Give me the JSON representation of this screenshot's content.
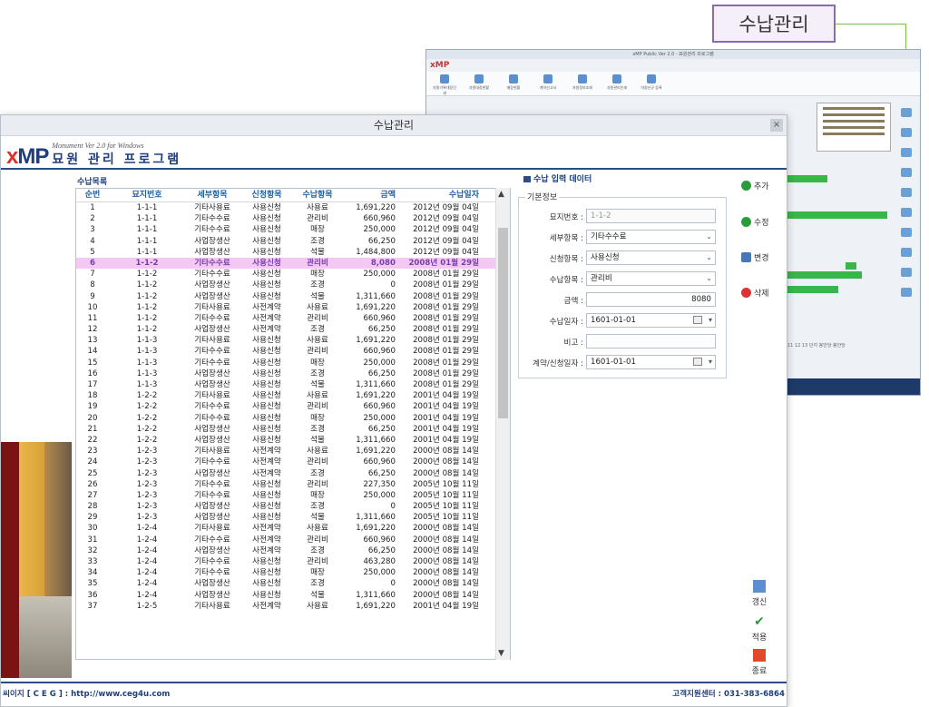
{
  "callout": {
    "label": "수납관리"
  },
  "background_window": {
    "title": "xMP Public Ver 2.0 - 묘원관리 프로그램",
    "logo": "xMP",
    "toolbar": [
      "자원기록대장인쇄",
      "자원대장현황",
      "매장현황",
      "계약신고서",
      "자원정보조회",
      "자원관리인쇄",
      "자원신규 등록"
    ],
    "pager": "11  12  13  단지  봉안당  봉안당"
  },
  "window": {
    "title": "수납관리",
    "close_icon": "close-icon"
  },
  "brand": {
    "xmp_x": "x",
    "xmp_mp": "MP",
    "subtitle": "Monument Ver 2.0 for Windows",
    "title": "묘원 관리 프로그램"
  },
  "list": {
    "title": "수납목록",
    "headers": [
      "순번",
      "묘지번호",
      "세부항목",
      "신청항목",
      "수납항목",
      "금액",
      "수납일자"
    ],
    "selected_index": 5,
    "rows": [
      [
        "1",
        "1-1-1",
        "기타사용료",
        "사용신청",
        "사용료",
        "1,691,220",
        "2012년 09월 04일"
      ],
      [
        "2",
        "1-1-1",
        "기타수수료",
        "사용신청",
        "관리비",
        "660,960",
        "2012년 09월 04일"
      ],
      [
        "3",
        "1-1-1",
        "기타수수료",
        "사용신청",
        "매장",
        "250,000",
        "2012년 09월 04일"
      ],
      [
        "4",
        "1-1-1",
        "사업장생산",
        "사용신청",
        "조경",
        "66,250",
        "2012년 09월 04일"
      ],
      [
        "5",
        "1-1-1",
        "사업장생산",
        "사용신청",
        "석물",
        "1,484,800",
        "2012년 09월 04일"
      ],
      [
        "6",
        "1-1-2",
        "기타수수료",
        "사용신청",
        "관리비",
        "8,080",
        "2008년 01월 29일"
      ],
      [
        "7",
        "1-1-2",
        "기타수수료",
        "사용신청",
        "매장",
        "250,000",
        "2008년 01월 29일"
      ],
      [
        "8",
        "1-1-2",
        "사업장생산",
        "사용신청",
        "조경",
        "0",
        "2008년 01월 29일"
      ],
      [
        "9",
        "1-1-2",
        "사업장생산",
        "사용신청",
        "석물",
        "1,311,660",
        "2008년 01월 29일"
      ],
      [
        "10",
        "1-1-2",
        "기타사용료",
        "사전계약",
        "사용료",
        "1,691,220",
        "2008년 01월 29일"
      ],
      [
        "11",
        "1-1-2",
        "기타수수료",
        "사전계약",
        "관리비",
        "660,960",
        "2008년 01월 29일"
      ],
      [
        "12",
        "1-1-2",
        "사업장생산",
        "사전계약",
        "조경",
        "66,250",
        "2008년 01월 29일"
      ],
      [
        "13",
        "1-1-3",
        "기타사용료",
        "사용신청",
        "사용료",
        "1,691,220",
        "2008년 01월 29일"
      ],
      [
        "14",
        "1-1-3",
        "기타수수료",
        "사용신청",
        "관리비",
        "660,960",
        "2008년 01월 29일"
      ],
      [
        "15",
        "1-1-3",
        "기타수수료",
        "사용신청",
        "매장",
        "250,000",
        "2008년 01월 29일"
      ],
      [
        "16",
        "1-1-3",
        "사업장생산",
        "사용신청",
        "조경",
        "66,250",
        "2008년 01월 29일"
      ],
      [
        "17",
        "1-1-3",
        "사업장생산",
        "사용신청",
        "석물",
        "1,311,660",
        "2008년 01월 29일"
      ],
      [
        "18",
        "1-2-2",
        "기타사용료",
        "사용신청",
        "사용료",
        "1,691,220",
        "2001년 04월 19일"
      ],
      [
        "19",
        "1-2-2",
        "기타수수료",
        "사용신청",
        "관리비",
        "660,960",
        "2001년 04월 19일"
      ],
      [
        "20",
        "1-2-2",
        "기타수수료",
        "사용신청",
        "매장",
        "250,000",
        "2001년 04월 19일"
      ],
      [
        "21",
        "1-2-2",
        "사업장생산",
        "사용신청",
        "조경",
        "66,250",
        "2001년 04월 19일"
      ],
      [
        "22",
        "1-2-2",
        "사업장생산",
        "사용신청",
        "석물",
        "1,311,660",
        "2001년 04월 19일"
      ],
      [
        "23",
        "1-2-3",
        "기타사용료",
        "사전계약",
        "사용료",
        "1,691,220",
        "2000년 08월 14일"
      ],
      [
        "24",
        "1-2-3",
        "기타수수료",
        "사전계약",
        "관리비",
        "660,960",
        "2000년 08월 14일"
      ],
      [
        "25",
        "1-2-3",
        "사업장생산",
        "사전계약",
        "조경",
        "66,250",
        "2000년 08월 14일"
      ],
      [
        "26",
        "1-2-3",
        "기타수수료",
        "사용신청",
        "관리비",
        "227,350",
        "2005년 10월 11일"
      ],
      [
        "27",
        "1-2-3",
        "기타수수료",
        "사용신청",
        "매장",
        "250,000",
        "2005년 10월 11일"
      ],
      [
        "28",
        "1-2-3",
        "사업장생산",
        "사용신청",
        "조경",
        "0",
        "2005년 10월 11일"
      ],
      [
        "29",
        "1-2-3",
        "사업장생산",
        "사용신청",
        "석물",
        "1,311,660",
        "2005년 10월 11일"
      ],
      [
        "30",
        "1-2-4",
        "기타사용료",
        "사전계약",
        "사용료",
        "1,691,220",
        "2000년 08월 14일"
      ],
      [
        "31",
        "1-2-4",
        "기타수수료",
        "사전계약",
        "관리비",
        "660,960",
        "2000년 08월 14일"
      ],
      [
        "32",
        "1-2-4",
        "사업장생산",
        "사전계약",
        "조경",
        "66,250",
        "2000년 08월 14일"
      ],
      [
        "33",
        "1-2-4",
        "기타수수료",
        "사용신청",
        "관리비",
        "463,280",
        "2000년 08월 14일"
      ],
      [
        "34",
        "1-2-4",
        "기타수수료",
        "사용신청",
        "매장",
        "250,000",
        "2000년 08월 14일"
      ],
      [
        "35",
        "1-2-4",
        "사업장생산",
        "사용신청",
        "조경",
        "0",
        "2000년 08월 14일"
      ],
      [
        "36",
        "1-2-4",
        "사업장생산",
        "사용신청",
        "석물",
        "1,311,660",
        "2000년 08월 14일"
      ],
      [
        "37",
        "1-2-5",
        "기타사용료",
        "사전계약",
        "사용료",
        "1,691,220",
        "2001년 04월 19일"
      ]
    ]
  },
  "form": {
    "title": "수납 입력 데이터",
    "section": "기본정보",
    "fields": {
      "grave_no": {
        "label": "묘지번호 :",
        "value": "1-1-2"
      },
      "detail": {
        "label": "세부항목 :",
        "value": "기타수수료"
      },
      "apply": {
        "label": "신청항목 :",
        "value": "사용신청"
      },
      "payitem": {
        "label": "수납항목 :",
        "value": "관리비"
      },
      "amount": {
        "label": "금액 :",
        "value": "8080"
      },
      "paydate": {
        "label": "수납일자 :",
        "value": "1601-01-01"
      },
      "note": {
        "label": "비고 :",
        "value": ""
      },
      "contract_date": {
        "label": "계약/신청일자 :",
        "value": "1601-01-01"
      }
    }
  },
  "actions": {
    "add": "추가",
    "edit": "수정",
    "change": "변경",
    "delete": "삭제",
    "refresh": "갱신",
    "apply": "적용",
    "exit": "종료"
  },
  "footer": {
    "left": "씨이지 [ C E G ] : http://www.ceg4u.com",
    "right": "고객지원센터 : 031-383-6864"
  },
  "colors": {
    "brand_red": "#e0302c",
    "brand_navy": "#1f3e7c",
    "selected_row": "#f3c8f3",
    "highlight_green": "#3ab54a"
  }
}
